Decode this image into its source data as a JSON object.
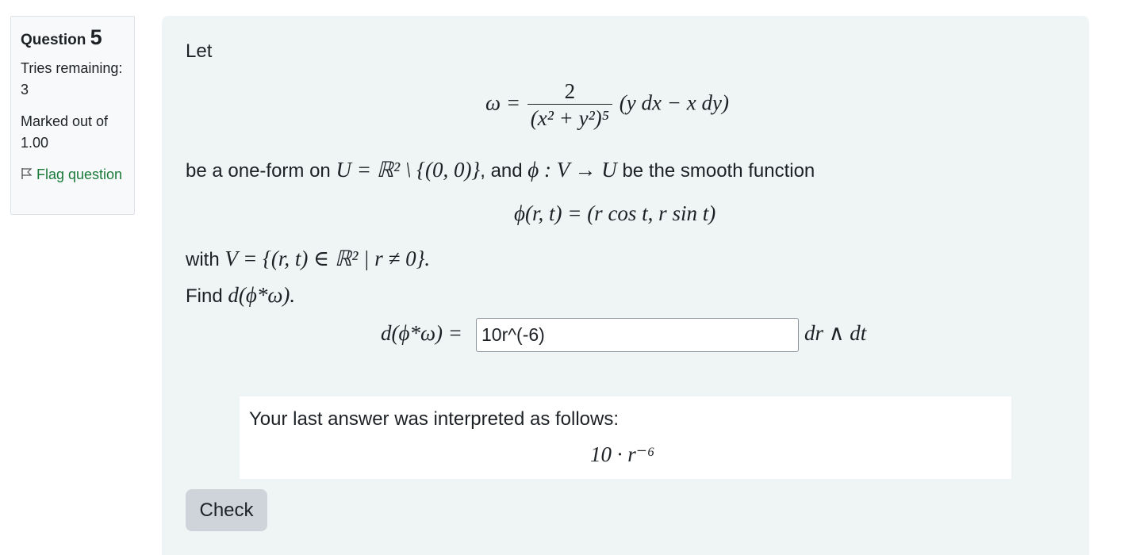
{
  "question_info": {
    "label": "Question",
    "number": "5",
    "state": "Tries remaining: 3",
    "grade": "Marked out of 1.00",
    "flag_label": "Flag question",
    "flag_icon": "flag-outline-icon"
  },
  "question": {
    "intro": "Let",
    "omega_lhs": "ω =",
    "omega_numerator": "2",
    "omega_denominator": "(x² + y²)⁵",
    "omega_rest": "(y dx − x dy)",
    "line2_pre": "be a one-form on",
    "line2_math1": "U = ℝ² \\ {(0, 0)}",
    "line2_mid": ", and",
    "line2_math2": "ϕ : V → U",
    "line2_post": "be the smooth function",
    "phi_def": "ϕ(r, t) = (r cos t, r sin t)",
    "line3_pre": "with",
    "line3_math": "V = {(r, t) ∈ ℝ² | r ≠ 0}.",
    "find_pre": "Find",
    "find_math": "d(ϕ*ω).",
    "answer_lhs": "d(ϕ*ω) =",
    "answer_value": "10r^(-6)",
    "answer_rhs": "dr ∧ dt"
  },
  "feedback": {
    "label": "Your last answer was interpreted as follows:",
    "interpreted": "10 · r⁻⁶"
  },
  "actions": {
    "check_label": "Check"
  }
}
